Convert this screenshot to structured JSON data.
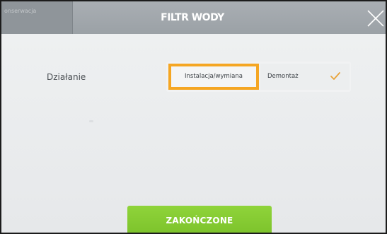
{
  "header": {
    "back_label": "onserwacja",
    "title": "FILTR WODY",
    "close_icon": "close-icon"
  },
  "form": {
    "row_label": "Działanie",
    "options": [
      {
        "label": "Instalacja/wymiana",
        "selected": false,
        "highlighted": true
      },
      {
        "label": "Demontaż",
        "selected": true,
        "check_icon": "check-icon"
      }
    ]
  },
  "footer": {
    "finish_label": "ZAKOŃCZONE"
  },
  "colors": {
    "header_bg": "#9ba1a6",
    "highlight": "#f5a623",
    "check": "#e8a33a",
    "finish_button": "#84c930"
  }
}
